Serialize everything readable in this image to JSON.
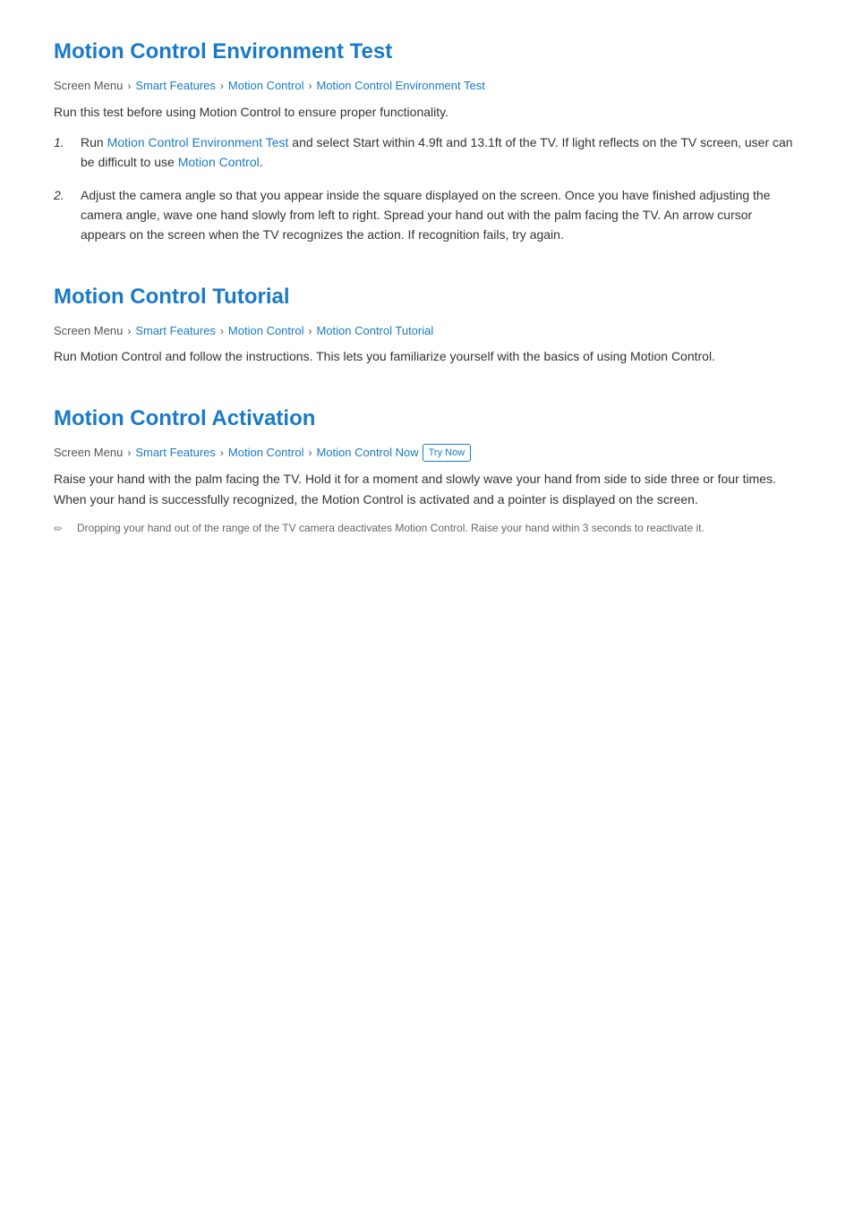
{
  "section1": {
    "title": "Motion Control Environment Test",
    "breadcrumb": {
      "items": [
        {
          "text": "Screen Menu",
          "link": false
        },
        {
          "text": "Smart Features",
          "link": true
        },
        {
          "text": "Motion Control",
          "link": true
        },
        {
          "text": "Motion Control Environment Test",
          "link": true
        }
      ]
    },
    "description": "Run this test before using Motion Control to ensure proper functionality.",
    "list_items": [
      {
        "number": "1.",
        "content_parts": [
          {
            "text": "Run ",
            "link": false
          },
          {
            "text": "Motion Control Environment Test",
            "link": true
          },
          {
            "text": " and select Start within 4.9ft and 13.1ft of the TV. If light reflects on the TV screen, user can be difficult to use ",
            "link": false
          },
          {
            "text": "Motion Control",
            "link": true
          },
          {
            "text": ".",
            "link": false
          }
        ]
      },
      {
        "number": "2.",
        "content_parts": [
          {
            "text": "Adjust the camera angle so that you appear inside the square displayed on the screen. Once you have finished adjusting the camera angle, wave one hand slowly from left to right. Spread your hand out with the palm facing the TV. An arrow cursor appears on the screen when the TV recognizes the action. If recognition fails, try again.",
            "link": false
          }
        ]
      }
    ]
  },
  "section2": {
    "title": "Motion Control Tutorial",
    "breadcrumb": {
      "items": [
        {
          "text": "Screen Menu",
          "link": false
        },
        {
          "text": "Smart Features",
          "link": true
        },
        {
          "text": "Motion Control",
          "link": true
        },
        {
          "text": "Motion Control Tutorial",
          "link": true
        }
      ]
    },
    "description": "Run Motion Control and follow the instructions. This lets you familiarize yourself with the basics of using Motion Control."
  },
  "section3": {
    "title": "Motion Control Activation",
    "breadcrumb": {
      "items": [
        {
          "text": "Screen Menu",
          "link": false
        },
        {
          "text": "Smart Features",
          "link": true
        },
        {
          "text": "Motion Control",
          "link": true
        },
        {
          "text": "Motion Control",
          "link": true
        }
      ],
      "try_now": true,
      "try_now_label": "Try Now"
    },
    "description": "Raise your hand with the palm facing the TV. Hold it for a moment and slowly wave your hand from side to side three or four times. When your hand is successfully recognized, the Motion Control is activated and a pointer is displayed on the screen.",
    "note": "Dropping your hand out of the range of the TV camera deactivates Motion Control. Raise your hand within 3 seconds to reactivate it."
  },
  "colors": {
    "link": "#1a7ac7",
    "title": "#1a7ac7",
    "text": "#333333",
    "note": "#666666"
  }
}
